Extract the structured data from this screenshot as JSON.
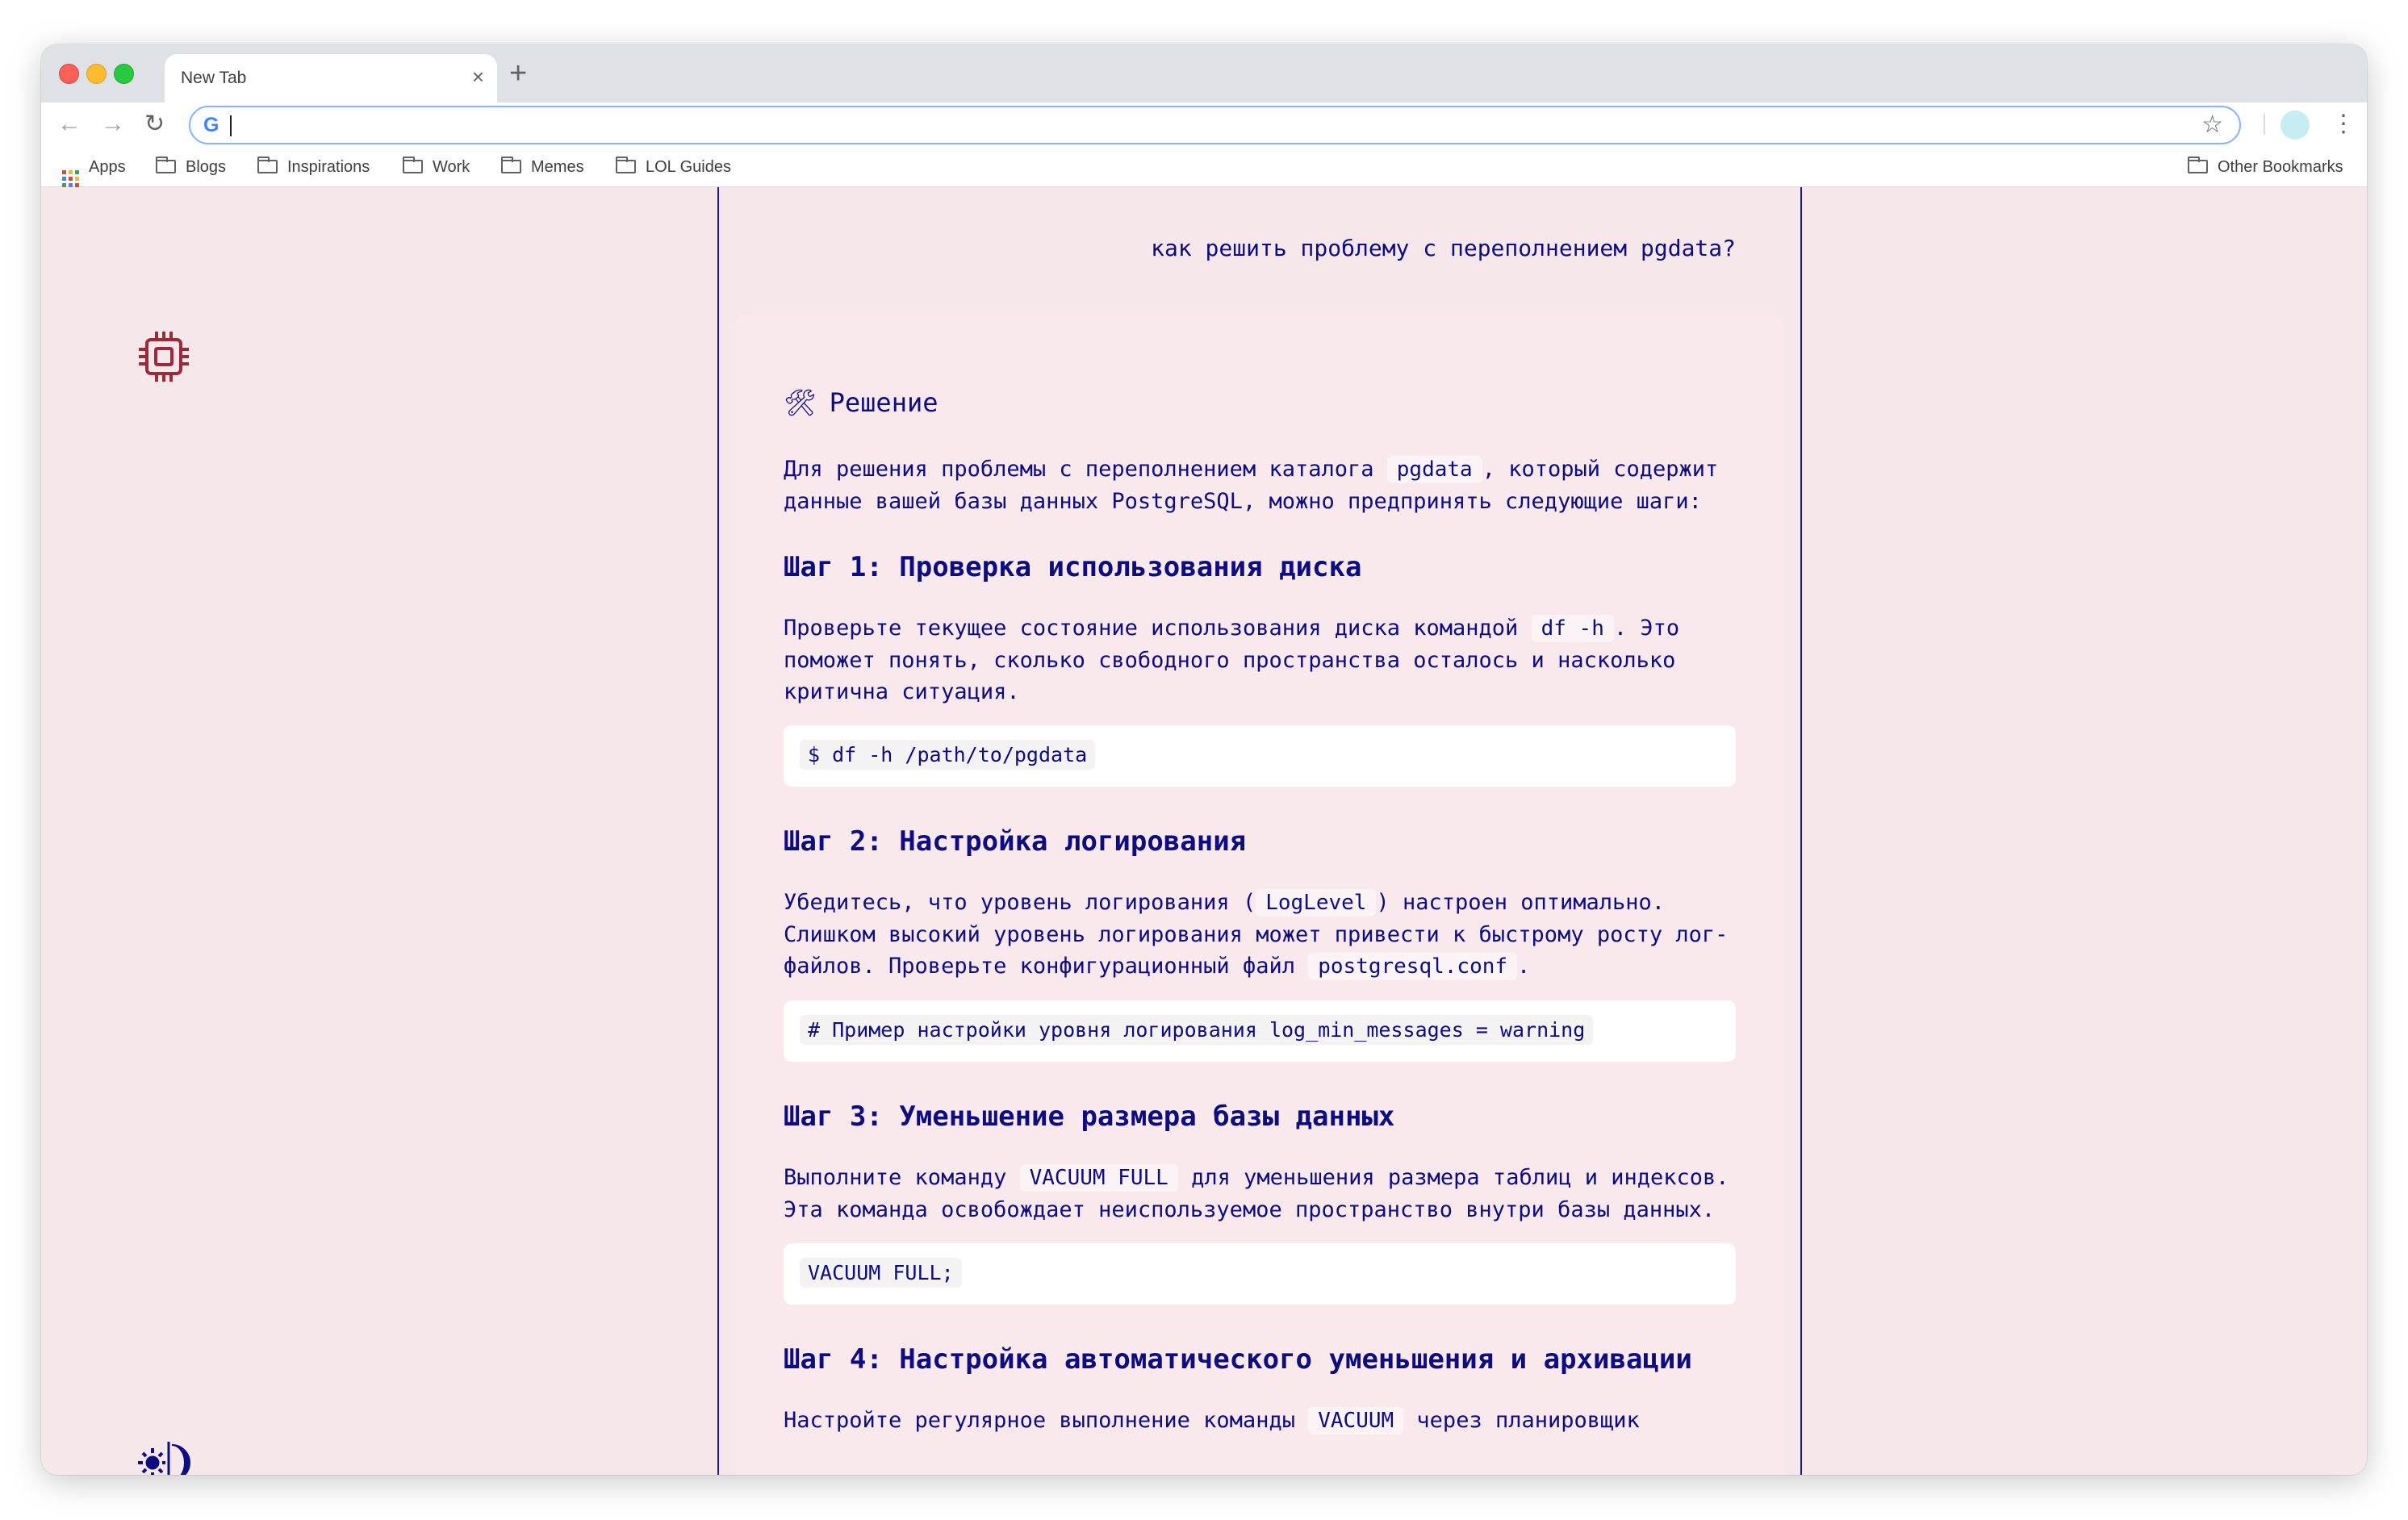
{
  "browser": {
    "tab_title": "New Tab",
    "tab_close": "×",
    "new_tab": "+",
    "address_value": "",
    "bookmarks": [
      {
        "label": "Apps"
      },
      {
        "label": "Blogs"
      },
      {
        "label": "Inspirations"
      },
      {
        "label": "Work"
      },
      {
        "label": "Memes"
      },
      {
        "label": "LOL Guides"
      }
    ],
    "other_bookmarks": "Other Bookmarks"
  },
  "chat": {
    "user_question": "как решить проблему с переполнением pgdata?",
    "answer": {
      "title_icon": "🛠",
      "title": "Решение",
      "intro_before": "Для решения проблемы с переполнением каталога",
      "intro_code": "pgdata",
      "intro_after": ", который содержит данные вашей базы данных PostgreSQL, можно предпринять следующие шаги:",
      "steps": [
        {
          "heading": "Шаг 1: Проверка использования диска",
          "text_before": "Проверьте текущее состояние использования диска командой",
          "text_code": "df -h",
          "text_after": ". Это поможет понять, сколько свободного пространства осталось и насколько критична ситуация.",
          "code": "$ df -h /path/to/pgdata"
        },
        {
          "heading": "Шаг 2: Настройка логирования",
          "text_before": "Убедитесь, что уровень логирования (",
          "text_code": "LogLevel",
          "text_middle": ") настроен оптимально. Слишком высокий уровень логирования может привести к быстрому росту лог-файлов. Проверьте конфигурационный файл",
          "text_code2": "postgresql.conf",
          "text_after": ".",
          "code": "# Пример настройки уровня логирования log_min_messages = warning"
        },
        {
          "heading": "Шаг 3: Уменьшение размера базы данных",
          "text_before": "Выполните команду",
          "text_code": "VACUUM FULL",
          "text_after": "для уменьшения размера таблиц и индексов. Эта команда освобождает неиспользуемое пространство внутри базы данных.",
          "code": "VACUUM FULL;"
        },
        {
          "heading": "Шаг 4: Настройка автоматического уменьшения и архивации",
          "text_before": "Настройте регулярное выполнение команды",
          "text_code": "VACUUM",
          "text_after": "через планировщик"
        }
      ]
    }
  },
  "icons": {
    "app_logo": "cpu-chip-icon",
    "theme_toggle": "sun-moon-icon"
  },
  "colors": {
    "page_bg": "#f6e7ea",
    "text": "#0d0d80",
    "logo": "#9b2a3a",
    "border": "#1a1a8c"
  }
}
